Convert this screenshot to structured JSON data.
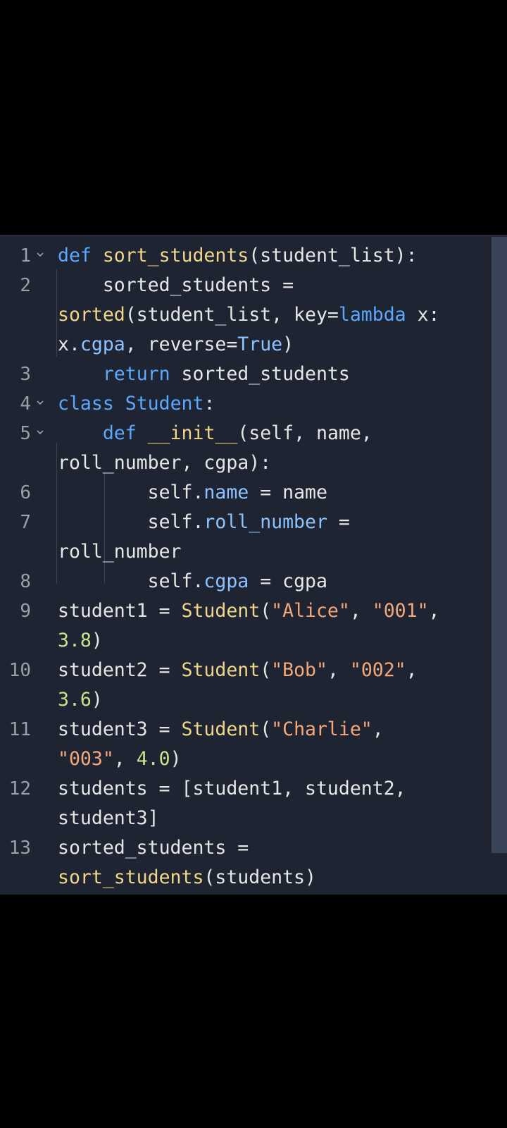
{
  "editor": {
    "lines": [
      {
        "n": "1",
        "fold": true,
        "segments": [
          {
            "t": "def",
            "c": "kw"
          },
          {
            "t": " ",
            "c": "plain"
          },
          {
            "t": "sort_students",
            "c": "fn"
          },
          {
            "t": "(student_list):",
            "c": "plain"
          }
        ]
      },
      {
        "n": "2",
        "fold": false,
        "segments": [
          {
            "t": "    sorted_students = ",
            "c": "plain"
          }
        ]
      },
      {
        "n": "",
        "fold": false,
        "segments": [
          {
            "t": "sorted",
            "c": "fn"
          },
          {
            "t": "(student_list, key=",
            "c": "plain"
          },
          {
            "t": "lambda",
            "c": "kw"
          },
          {
            "t": " x:",
            "c": "plain"
          }
        ]
      },
      {
        "n": "",
        "fold": false,
        "segments": [
          {
            "t": "x.",
            "c": "plain"
          },
          {
            "t": "cgpa",
            "c": "attr"
          },
          {
            "t": ", reverse=",
            "c": "plain"
          },
          {
            "t": "True",
            "c": "attr"
          },
          {
            "t": ")",
            "c": "plain"
          }
        ]
      },
      {
        "n": "3",
        "fold": false,
        "segments": [
          {
            "t": "    ",
            "c": "plain"
          },
          {
            "t": "return",
            "c": "kw"
          },
          {
            "t": " sorted_students",
            "c": "plain"
          }
        ]
      },
      {
        "n": "4",
        "fold": true,
        "segments": [
          {
            "t": "class",
            "c": "kw"
          },
          {
            "t": " ",
            "c": "plain"
          },
          {
            "t": "Student",
            "c": "kw"
          },
          {
            "t": ":",
            "c": "plain"
          }
        ]
      },
      {
        "n": "5",
        "fold": true,
        "segments": [
          {
            "t": "    ",
            "c": "plain"
          },
          {
            "t": "def",
            "c": "kw"
          },
          {
            "t": " ",
            "c": "plain"
          },
          {
            "t": "__init__",
            "c": "fn"
          },
          {
            "t": "(self, name,",
            "c": "plain"
          }
        ]
      },
      {
        "n": "",
        "fold": false,
        "segments": [
          {
            "t": "roll_number, cgpa):",
            "c": "plain"
          }
        ]
      },
      {
        "n": "6",
        "fold": false,
        "segments": [
          {
            "t": "        self.",
            "c": "plain"
          },
          {
            "t": "name",
            "c": "attr"
          },
          {
            "t": " = name",
            "c": "plain"
          }
        ]
      },
      {
        "n": "7",
        "fold": false,
        "segments": [
          {
            "t": "        self.",
            "c": "plain"
          },
          {
            "t": "roll_number",
            "c": "attr"
          },
          {
            "t": " = ",
            "c": "plain"
          }
        ]
      },
      {
        "n": "",
        "fold": false,
        "segments": [
          {
            "t": "roll_number",
            "c": "plain"
          }
        ]
      },
      {
        "n": "8",
        "fold": false,
        "segments": [
          {
            "t": "        self.",
            "c": "plain"
          },
          {
            "t": "cgpa",
            "c": "attr"
          },
          {
            "t": " = cgpa",
            "c": "plain"
          }
        ]
      },
      {
        "n": "9",
        "fold": false,
        "segments": [
          {
            "t": "student1 = ",
            "c": "plain"
          },
          {
            "t": "Student",
            "c": "fn"
          },
          {
            "t": "(",
            "c": "plain"
          },
          {
            "t": "\"Alice\"",
            "c": "str"
          },
          {
            "t": ", ",
            "c": "plain"
          },
          {
            "t": "\"001\"",
            "c": "str"
          },
          {
            "t": ",",
            "c": "plain"
          }
        ]
      },
      {
        "n": "",
        "fold": false,
        "segments": [
          {
            "t": "3.8",
            "c": "num"
          },
          {
            "t": ")",
            "c": "plain"
          }
        ]
      },
      {
        "n": "10",
        "fold": false,
        "segments": [
          {
            "t": "student2 = ",
            "c": "plain"
          },
          {
            "t": "Student",
            "c": "fn"
          },
          {
            "t": "(",
            "c": "plain"
          },
          {
            "t": "\"Bob\"",
            "c": "str"
          },
          {
            "t": ", ",
            "c": "plain"
          },
          {
            "t": "\"002\"",
            "c": "str"
          },
          {
            "t": ",",
            "c": "plain"
          }
        ]
      },
      {
        "n": "",
        "fold": false,
        "segments": [
          {
            "t": "3.6",
            "c": "num"
          },
          {
            "t": ")",
            "c": "plain"
          }
        ]
      },
      {
        "n": "11",
        "fold": false,
        "segments": [
          {
            "t": "student3 = ",
            "c": "plain"
          },
          {
            "t": "Student",
            "c": "fn"
          },
          {
            "t": "(",
            "c": "plain"
          },
          {
            "t": "\"Charlie\"",
            "c": "str"
          },
          {
            "t": ",",
            "c": "plain"
          }
        ]
      },
      {
        "n": "",
        "fold": false,
        "segments": [
          {
            "t": "\"003\"",
            "c": "str"
          },
          {
            "t": ", ",
            "c": "plain"
          },
          {
            "t": "4.0",
            "c": "num"
          },
          {
            "t": ")",
            "c": "plain"
          }
        ]
      },
      {
        "n": "12",
        "fold": false,
        "segments": [
          {
            "t": "students = [student1, student2,",
            "c": "plain"
          }
        ]
      },
      {
        "n": "",
        "fold": false,
        "segments": [
          {
            "t": "student3]",
            "c": "plain"
          }
        ]
      },
      {
        "n": "13",
        "fold": false,
        "segments": [
          {
            "t": "sorted_students = ",
            "c": "plain"
          }
        ]
      },
      {
        "n": "",
        "fold": false,
        "segments": [
          {
            "t": "sort_students",
            "c": "fn"
          },
          {
            "t": "(students)",
            "c": "plain"
          }
        ]
      }
    ]
  }
}
